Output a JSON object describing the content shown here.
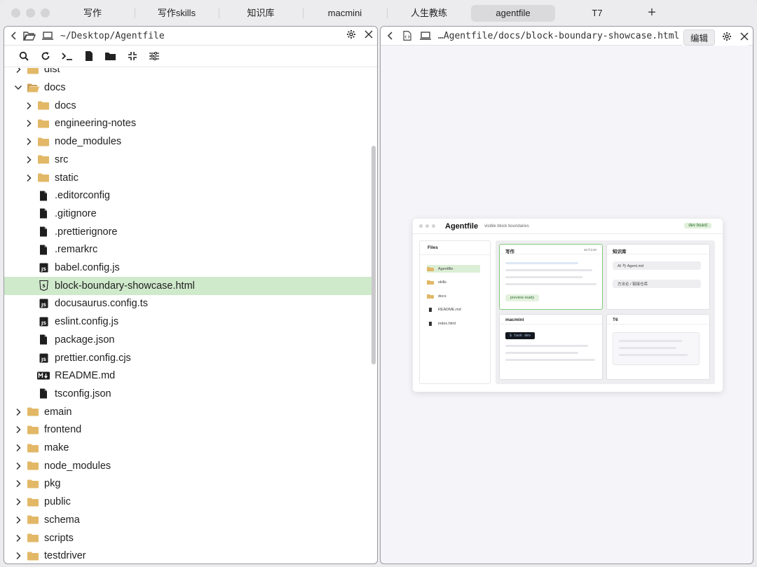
{
  "tabs": [
    {
      "label": "写作",
      "active": false
    },
    {
      "label": "写作skills",
      "active": false
    },
    {
      "label": "知识库",
      "active": false
    },
    {
      "label": "macmini",
      "active": false
    },
    {
      "label": "人生教练",
      "active": false
    },
    {
      "label": "agentfile",
      "active": true
    },
    {
      "label": "T7",
      "active": false
    }
  ],
  "tab_add": "+",
  "left_panel": {
    "path": "~/Desktop/Agentfile",
    "toolbar_icons": [
      "search-icon",
      "refresh-icon",
      "terminal-icon",
      "new-file-icon",
      "new-folder-icon",
      "collapse-icon",
      "settings-sliders-icon"
    ],
    "tree": [
      {
        "label": "dist",
        "type": "folder",
        "depth": 1,
        "expanded": false,
        "partial": true
      },
      {
        "label": "docs",
        "type": "folder",
        "depth": 1,
        "expanded": true
      },
      {
        "label": "docs",
        "type": "folder",
        "depth": 2,
        "expanded": false
      },
      {
        "label": "engineering-notes",
        "type": "folder",
        "depth": 2,
        "expanded": false
      },
      {
        "label": "node_modules",
        "type": "folder",
        "depth": 2,
        "expanded": false
      },
      {
        "label": "src",
        "type": "folder",
        "depth": 2,
        "expanded": false
      },
      {
        "label": "static",
        "type": "folder",
        "depth": 2,
        "expanded": false
      },
      {
        "label": ".editorconfig",
        "type": "file",
        "depth": 2
      },
      {
        "label": ".gitignore",
        "type": "file",
        "depth": 2
      },
      {
        "label": ".prettierignore",
        "type": "file",
        "depth": 2
      },
      {
        "label": ".remarkrc",
        "type": "file",
        "depth": 2
      },
      {
        "label": "babel.config.js",
        "type": "js",
        "depth": 2
      },
      {
        "label": "block-boundary-showcase.html",
        "type": "html",
        "depth": 2,
        "selected": true
      },
      {
        "label": "docusaurus.config.ts",
        "type": "js",
        "depth": 2
      },
      {
        "label": "eslint.config.js",
        "type": "js",
        "depth": 2
      },
      {
        "label": "package.json",
        "type": "file",
        "depth": 2
      },
      {
        "label": "prettier.config.cjs",
        "type": "js",
        "depth": 2
      },
      {
        "label": "README.md",
        "type": "md",
        "depth": 2
      },
      {
        "label": "tsconfig.json",
        "type": "file",
        "depth": 2
      },
      {
        "label": "emain",
        "type": "folder",
        "depth": 1,
        "expanded": false
      },
      {
        "label": "frontend",
        "type": "folder",
        "depth": 1,
        "expanded": false
      },
      {
        "label": "make",
        "type": "folder",
        "depth": 1,
        "expanded": false
      },
      {
        "label": "node_modules",
        "type": "folder",
        "depth": 1,
        "expanded": false
      },
      {
        "label": "pkg",
        "type": "folder",
        "depth": 1,
        "expanded": false
      },
      {
        "label": "public",
        "type": "folder",
        "depth": 1,
        "expanded": false
      },
      {
        "label": "schema",
        "type": "folder",
        "depth": 1,
        "expanded": false
      },
      {
        "label": "scripts",
        "type": "folder",
        "depth": 1,
        "expanded": false
      },
      {
        "label": "testdriver",
        "type": "folder",
        "depth": 1,
        "expanded": false
      }
    ]
  },
  "right_panel": {
    "path": "…Agentfile/docs/block-boundary-showcase.html",
    "edit_label": "编辑",
    "preview": {
      "title": "Agentfile",
      "subtitle": "visible block boundaries",
      "badge": "dev board",
      "files_title": "Files",
      "files": [
        {
          "label": "Agentfile",
          "type": "folder",
          "selected": true
        },
        {
          "label": "skills",
          "type": "folder"
        },
        {
          "label": "docs",
          "type": "folder"
        },
        {
          "label": "README.md",
          "type": "file"
        },
        {
          "label": "index.html",
          "type": "file"
        }
      ],
      "cards": [
        {
          "title": "写作",
          "tag": "active",
          "pill": "preview ready"
        },
        {
          "title": "知识库",
          "items": [
            "AI 与 Agent.md",
            "方法论 / 链接仓库"
          ]
        },
        {
          "title": "macmini",
          "terminal": "$ task dev"
        },
        {
          "title": "T6"
        }
      ]
    }
  },
  "colors": {
    "selected_row": "#cfe9cb",
    "folder": "#e2b867",
    "active_card_border": "#84c97b"
  }
}
